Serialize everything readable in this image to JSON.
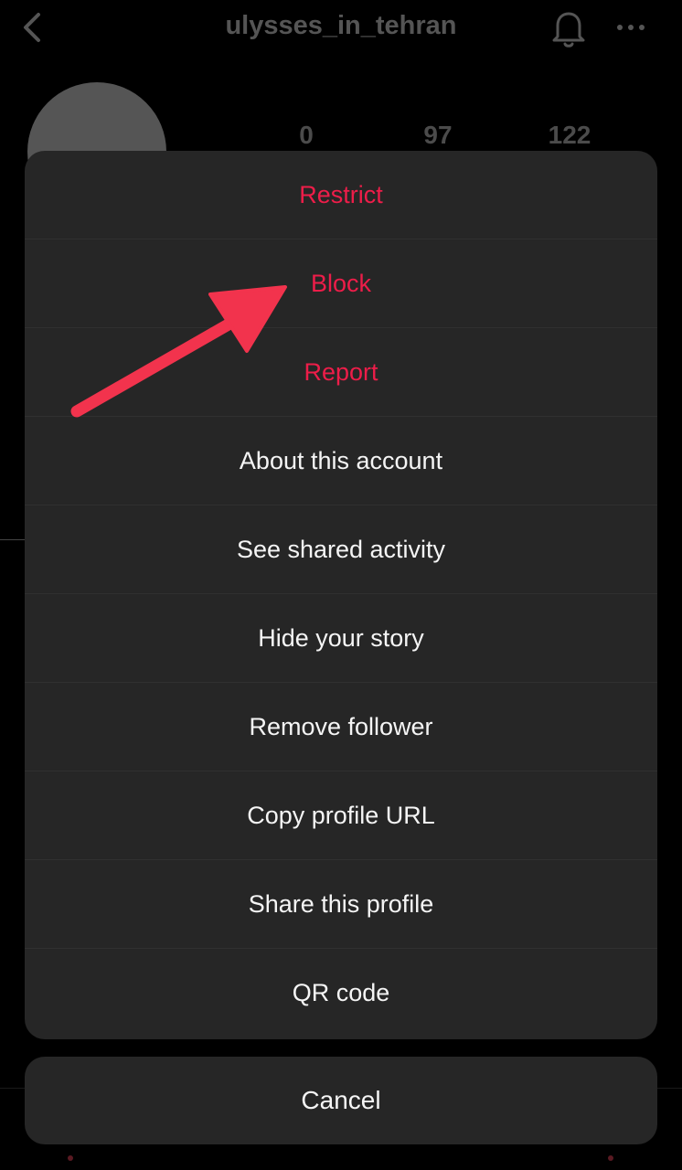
{
  "header": {
    "username": "ulysses_in_tehran",
    "back_icon": "chevron-left-icon",
    "bell_icon": "bell-icon",
    "more_icon": "more-horizontal-icon"
  },
  "profile": {
    "stats": {
      "posts": "0",
      "followers": "97",
      "following": "122"
    }
  },
  "sheet": {
    "items": [
      {
        "label": "Restrict",
        "style": "danger"
      },
      {
        "label": "Block",
        "style": "danger"
      },
      {
        "label": "Report",
        "style": "danger"
      },
      {
        "label": "About this account",
        "style": "normal"
      },
      {
        "label": "See shared activity",
        "style": "normal"
      },
      {
        "label": "Hide your story",
        "style": "normal"
      },
      {
        "label": "Remove follower",
        "style": "normal"
      },
      {
        "label": "Copy profile URL",
        "style": "normal"
      },
      {
        "label": "Share this profile",
        "style": "normal"
      },
      {
        "label": "QR code",
        "style": "normal"
      }
    ],
    "cancel_label": "Cancel"
  },
  "colors": {
    "danger": "#ed1d49",
    "sheet_background": "#262626",
    "annotation_arrow": "#f2334d"
  }
}
